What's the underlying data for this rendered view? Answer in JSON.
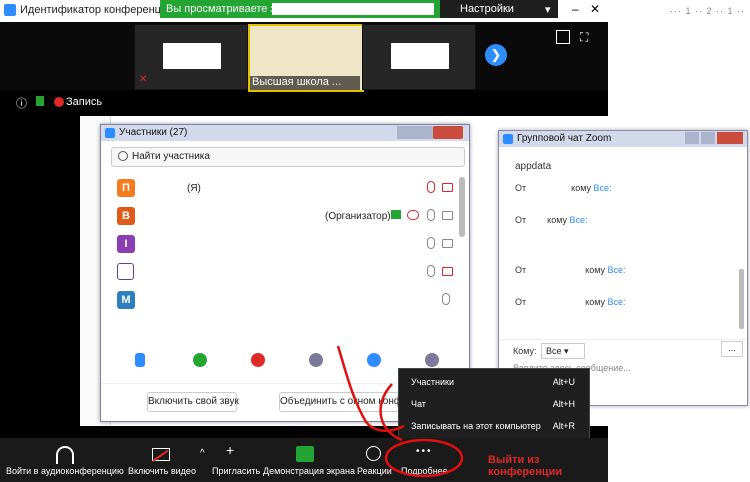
{
  "window": {
    "title": "Идентификатор конференции Zoom"
  },
  "share_banner": {
    "text": "Вы просматриваете экран"
  },
  "view_settings": {
    "label": "Настройки просмотра"
  },
  "thumbs": {
    "thumb2_name": "Высшая школа ..."
  },
  "status": {
    "recording": "Запись"
  },
  "participants": {
    "title": "Участники (27)",
    "search_placeholder": "Найти участника",
    "rows": [
      {
        "letter": "П",
        "color": "#f47b20",
        "name": "(Я)"
      },
      {
        "letter": "В",
        "color": "#e05a1a",
        "name": "(Организатор)"
      },
      {
        "letter": "I",
        "color": "#8a3fb0",
        "name": ""
      },
      {
        "letter": "",
        "color": "#6a3a9a",
        "name": ""
      },
      {
        "letter": "М",
        "color": "#2d7fc0",
        "name": ""
      }
    ],
    "unmute_btn": "Включить свой звук",
    "merge_btn": "Объединить с окном конфере"
  },
  "chat": {
    "title": "Групповой чат Zoom",
    "messages": [
      {
        "text": "appdata"
      },
      {
        "from": "От",
        "to_label": "кому",
        "to": "Все:"
      },
      {
        "from": "От",
        "to_label": "кому",
        "to": "Все:"
      },
      {
        "from": "От",
        "to_label": "кому",
        "to": "Все:"
      },
      {
        "from": "От",
        "to_label": "кому",
        "to": "Все:"
      }
    ],
    "to_label": "Кому:",
    "to_value": "Все",
    "input_placeholder": "Введите здесь сообщение...",
    "more": "..."
  },
  "menu": {
    "items": [
      {
        "label": "Участники",
        "shortcut": "Alt+U"
      },
      {
        "label": "Чат",
        "shortcut": "Alt+H"
      },
      {
        "label": "Записывать на этот компьютер",
        "shortcut": "Alt+R"
      }
    ]
  },
  "toolbar": {
    "audio": "Войти в аудиоконференцию",
    "video": "Включить видео",
    "invite": "Пригласить",
    "share": "Демонстрация экрана",
    "reactions": "Реакции",
    "more": "Подробнее",
    "more_icon": "•••",
    "leave": "Выйти из конференции"
  },
  "colors": {
    "accent": "#2d8cff",
    "green": "#23a433",
    "red": "#e02828"
  }
}
